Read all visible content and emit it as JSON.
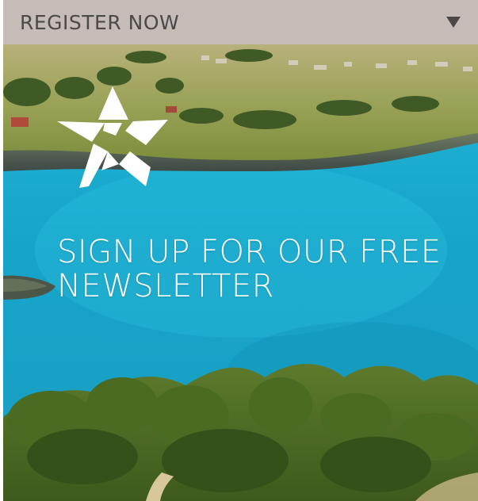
{
  "header": {
    "label": "REGISTER NOW",
    "arrow_icon": "caret-down-icon"
  },
  "hero": {
    "headline_line1": "SIGN UP FOR OUR FREE",
    "headline_line2": "NEWSLETTER",
    "logo_icon": "star-logo-icon"
  },
  "colors": {
    "header_bg": "#c5bcb8",
    "header_text": "#4b4848",
    "water": "#1aa6c8",
    "headline_text": "#ffffff"
  }
}
